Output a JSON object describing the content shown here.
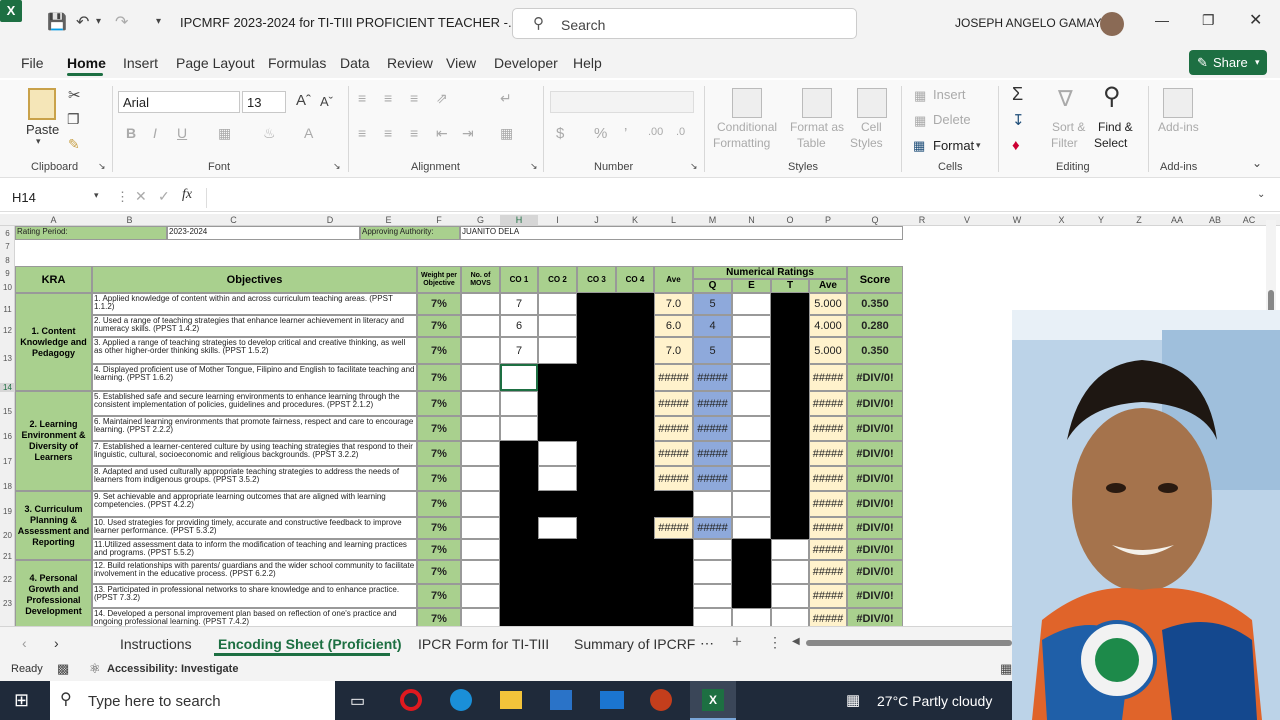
{
  "titlebar": {
    "title": "IPCMRF 2023-2024 for TI-TIII PROFICIENT TEACHER  -...",
    "search_placeholder": "Search",
    "user": "JOSEPH ANGELO  GAMAY"
  },
  "menu": [
    "File",
    "Home",
    "Insert",
    "Page Layout",
    "Formulas",
    "Data",
    "Review",
    "View",
    "Developer",
    "Help"
  ],
  "share_label": "Share",
  "ribbon": {
    "clipboard": {
      "paste": "Paste",
      "label": "Clipboard"
    },
    "font": {
      "family": "Arial",
      "size": "13",
      "label": "Font"
    },
    "alignment": {
      "label": "Alignment"
    },
    "number": {
      "label": "Number"
    },
    "styles": {
      "cond1": "Conditional",
      "cond2": "Formatting",
      "fmt1": "Format as",
      "fmt2": "Table",
      "cell1": "Cell",
      "cell2": "Styles",
      "label": "Styles"
    },
    "cells": {
      "insert": "Insert",
      "delete": "Delete",
      "format": "Format",
      "label": "Cells"
    },
    "editing": {
      "sort1": "Sort &",
      "sort2": "Filter",
      "find1": "Find &",
      "find2": "Select",
      "label": "Editing"
    },
    "addins": {
      "btn": "Add-ins",
      "label": "Add-ins"
    }
  },
  "formula_bar": {
    "name_box": "H14",
    "fx": "fx"
  },
  "columns": [
    "A",
    "B",
    "C",
    "D",
    "E",
    "F",
    "G",
    "H",
    "I",
    "J",
    "K",
    "L",
    "M",
    "N",
    "O",
    "P",
    "Q",
    "R",
    "V",
    "W",
    "X",
    "Y",
    "Z",
    "AA",
    "AB",
    "AC"
  ],
  "rows": [
    "6",
    "7",
    "8",
    "9",
    "10",
    "11",
    "12",
    "13",
    "14",
    "15",
    "16",
    "17",
    "18",
    "19",
    "20",
    "21",
    "22",
    "23"
  ],
  "sheet": {
    "rating_period_label": "Rating Period:",
    "rating_period": "2023-2024",
    "approving_label": "Approving Authority:",
    "approving": "JUANITO DELA",
    "headers": {
      "kra": "KRA",
      "objectives": "Objectives",
      "weight": "Weight per Objective",
      "movs": "No. of MOVS",
      "co1": "CO 1",
      "co2": "CO 2",
      "co3": "CO 3",
      "co4": "CO 4",
      "ave": "Ave",
      "numerical": "Numerical Ratings",
      "q": "Q",
      "e": "E",
      "t": "T",
      "ave2": "Ave",
      "score": "Score"
    },
    "kras": [
      "1. Content Knowledge and Pedagogy",
      "2. Learning Environment & Diversity of Learners",
      "3. Curriculum Planning & Assessment and Reporting",
      "4. Personal Growth and Professional Development"
    ],
    "objectives": [
      {
        "text": "1. Applied knowledge of content within and across curriculum teaching areas. (PPST 1.1.2)",
        "weight": "7%",
        "co1": "7",
        "ave": "7.0",
        "q": "5",
        "ave2": "5.000",
        "score": "0.350"
      },
      {
        "text": "2. Used a range of teaching strategies that enhance learner achievement in literacy and numeracy skills. (PPST 1.4.2)",
        "weight": "7%",
        "co1": "6",
        "ave": "6.0",
        "q": "4",
        "ave2": "4.000",
        "score": "0.280"
      },
      {
        "text": "3. Applied a range of teaching strategies to develop critical and creative thinking, as well as other higher-order thinking skills. (PPST 1.5.2)",
        "weight": "7%",
        "co1": "7",
        "ave": "7.0",
        "q": "5",
        "ave2": "5.000",
        "score": "0.350"
      },
      {
        "text": "4. Displayed proficient use of  Mother Tongue,  Filipino and English to facilitate teaching and learning. (PPST 1.6.2)",
        "weight": "7%",
        "co1": "",
        "ave": "#####",
        "q": "#####",
        "ave2": "#####",
        "score": "#DIV/0!"
      },
      {
        "text": "5. Established safe and secure learning environments to enhance learning through the consistent implementation of policies, guidelines and procedures. (PPST 2.1.2)",
        "weight": "7%",
        "co1": "",
        "ave": "#####",
        "q": "#####",
        "ave2": "#####",
        "score": "#DIV/0!"
      },
      {
        "text": "6. Maintained learning environments that promote fairness, respect and care to encourage learning. (PPST 2.2.2)",
        "weight": "7%",
        "co1": "",
        "ave": "#####",
        "q": "#####",
        "ave2": "#####",
        "score": "#DIV/0!"
      },
      {
        "text": "7. Established a learner-centered culture by using teaching strategies that respond to their linguistic, cultural, socioeconomic and religious backgrounds. (PPST 3.2.2)",
        "weight": "7%",
        "co1": "",
        "ave": "#####",
        "q": "#####",
        "ave2": "#####",
        "score": "#DIV/0!"
      },
      {
        "text": "8. Adapted and used culturally appropriate teaching strategies to address the needs of learners from indigenous groups. (PPST 3.5.2)",
        "weight": "7%",
        "co1": "",
        "ave": "#####",
        "q": "#####",
        "ave2": "#####",
        "score": "#DIV/0!"
      },
      {
        "text": "9. Set achievable and appropriate learning outcomes that are aligned with learning competencies. (PPST 4.2.2)",
        "weight": "7%",
        "co1": "",
        "ave": "",
        "q": "",
        "ave2": "#####",
        "score": "#DIV/0!"
      },
      {
        "text": "10. Used strategies for providing timely, accurate and constructive feedback to improve learner performance. (PPST 5.3.2)",
        "weight": "7%",
        "co1": "",
        "ave": "#####",
        "q": "#####",
        "ave2": "#####",
        "score": "#DIV/0!"
      },
      {
        "text": "11.Utilized assessment data to inform the modification of teaching and learning practices and programs. (PPST 5.5.2)",
        "weight": "7%",
        "co1": "",
        "ave": "",
        "q": "",
        "ave2": "#####",
        "score": "#DIV/0!"
      },
      {
        "text": "12. Build relationships with parents/ guardians and the wider school community to facilitate involvement in the educative process. (PPST 6.2.2)",
        "weight": "7%",
        "co1": "",
        "ave": "",
        "q": "",
        "ave2": "#####",
        "score": "#DIV/0!"
      },
      {
        "text": "13. Participated in professional networks to share knowledge and to enhance practice. (PPST 7.3.2)",
        "weight": "7%",
        "co1": "",
        "ave": "",
        "q": "",
        "ave2": "#####",
        "score": "#DIV/0!"
      },
      {
        "text": "14. Developed a personal improvement plan based on reflection of one's practice and ongoing professional learning. (PPST 7.4.2)",
        "weight": "7%",
        "co1": "",
        "ave": "",
        "q": "",
        "ave2": "#####",
        "score": "#DIV/0!"
      }
    ]
  },
  "tabs": [
    "Instructions",
    "Encoding Sheet (Proficient)",
    "IPCR Form for TI-TIII",
    "Summary of IPCRF"
  ],
  "status": {
    "ready": "Ready",
    "accessibility": "Accessibility: Investigate"
  },
  "taskbar": {
    "search": "Type here to search",
    "weather": "27°C  Partly cloudy"
  },
  "colors": {
    "accent": "#1d6f42",
    "header_green": "#a9d08e",
    "ave_yellow": "#fff2cc",
    "rating_blue": "#8ea9db"
  }
}
